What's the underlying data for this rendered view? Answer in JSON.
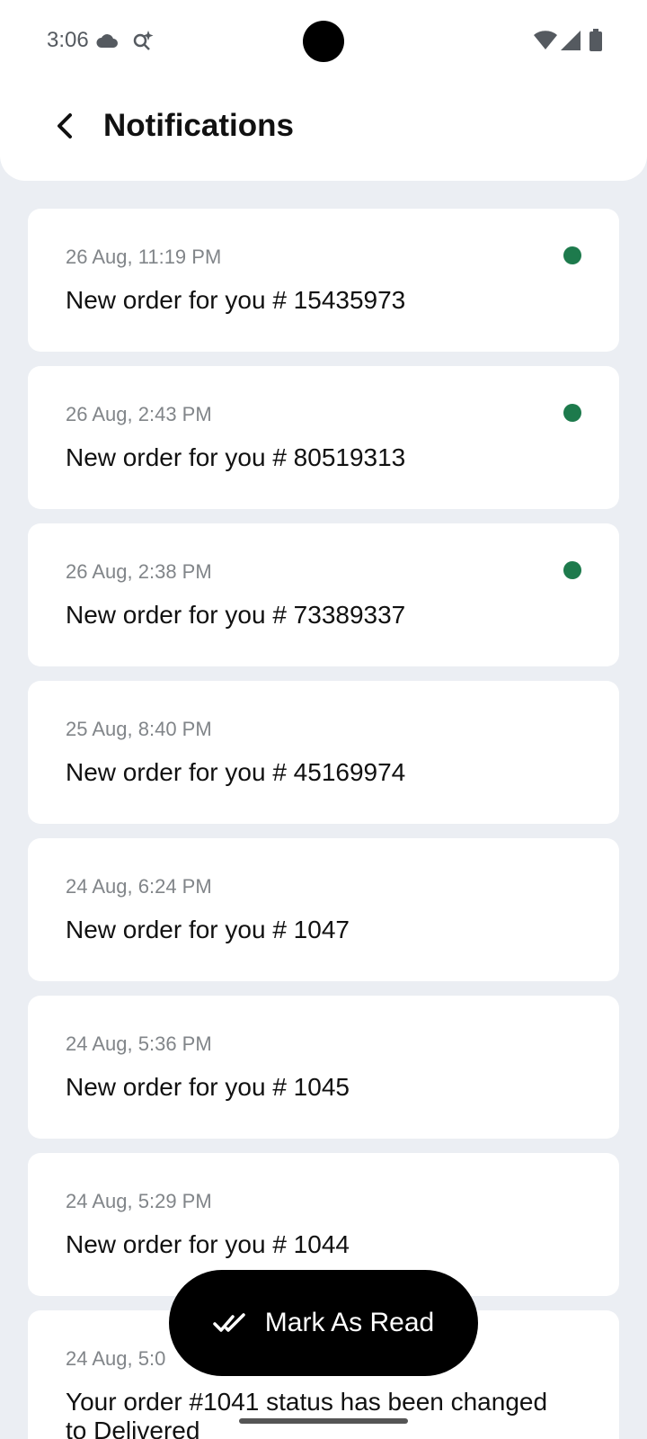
{
  "status_bar": {
    "time": "3:06",
    "icons": [
      "cloud-icon",
      "assistant-sparkle-icon",
      "wifi-icon",
      "signal-icon",
      "battery-icon"
    ]
  },
  "header": {
    "title": "Notifications",
    "back_icon": "chevron-left-icon"
  },
  "colors": {
    "unread_dot": "#1d7a4c",
    "background": "#ebeef3",
    "card": "#ffffff",
    "fab": "#000000"
  },
  "notifications": [
    {
      "date": "26 Aug, 11:19 PM",
      "message": "New order for you # 15435973",
      "unread": true
    },
    {
      "date": "26 Aug, 2:43 PM",
      "message": "New order for you # 80519313",
      "unread": true
    },
    {
      "date": "26 Aug, 2:38 PM",
      "message": "New order for you # 73389337",
      "unread": true
    },
    {
      "date": "25 Aug, 8:40 PM",
      "message": "New order for you # 45169974",
      "unread": false
    },
    {
      "date": "24 Aug, 6:24 PM",
      "message": "New order for you # 1047",
      "unread": false
    },
    {
      "date": "24 Aug, 5:36 PM",
      "message": "New order for you # 1045",
      "unread": false
    },
    {
      "date": "24 Aug, 5:29 PM",
      "message": "New order for you # 1044",
      "unread": false
    },
    {
      "date": "24 Aug, 5:0",
      "message": "Your order #1041 status has been changed to Delivered",
      "unread": false
    }
  ],
  "fab": {
    "label": "Mark As Read",
    "icon": "double-check-icon"
  }
}
